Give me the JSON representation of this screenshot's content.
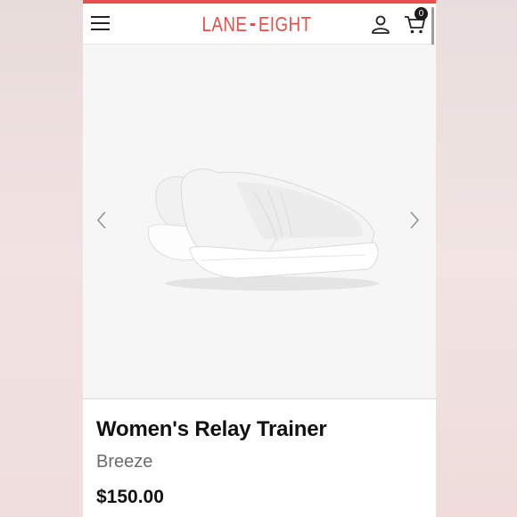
{
  "header": {
    "logo_left": "LANE",
    "logo_right": "EIGHT",
    "cart_count": "0",
    "accent_color": "#e2514c"
  },
  "gallery": {
    "image_description": "white-sneaker",
    "prev_icon": "chevron-left-icon",
    "next_icon": "chevron-right-icon"
  },
  "product": {
    "title": "Women's Relay Trainer",
    "color": "Breeze",
    "price": "$150.00"
  }
}
